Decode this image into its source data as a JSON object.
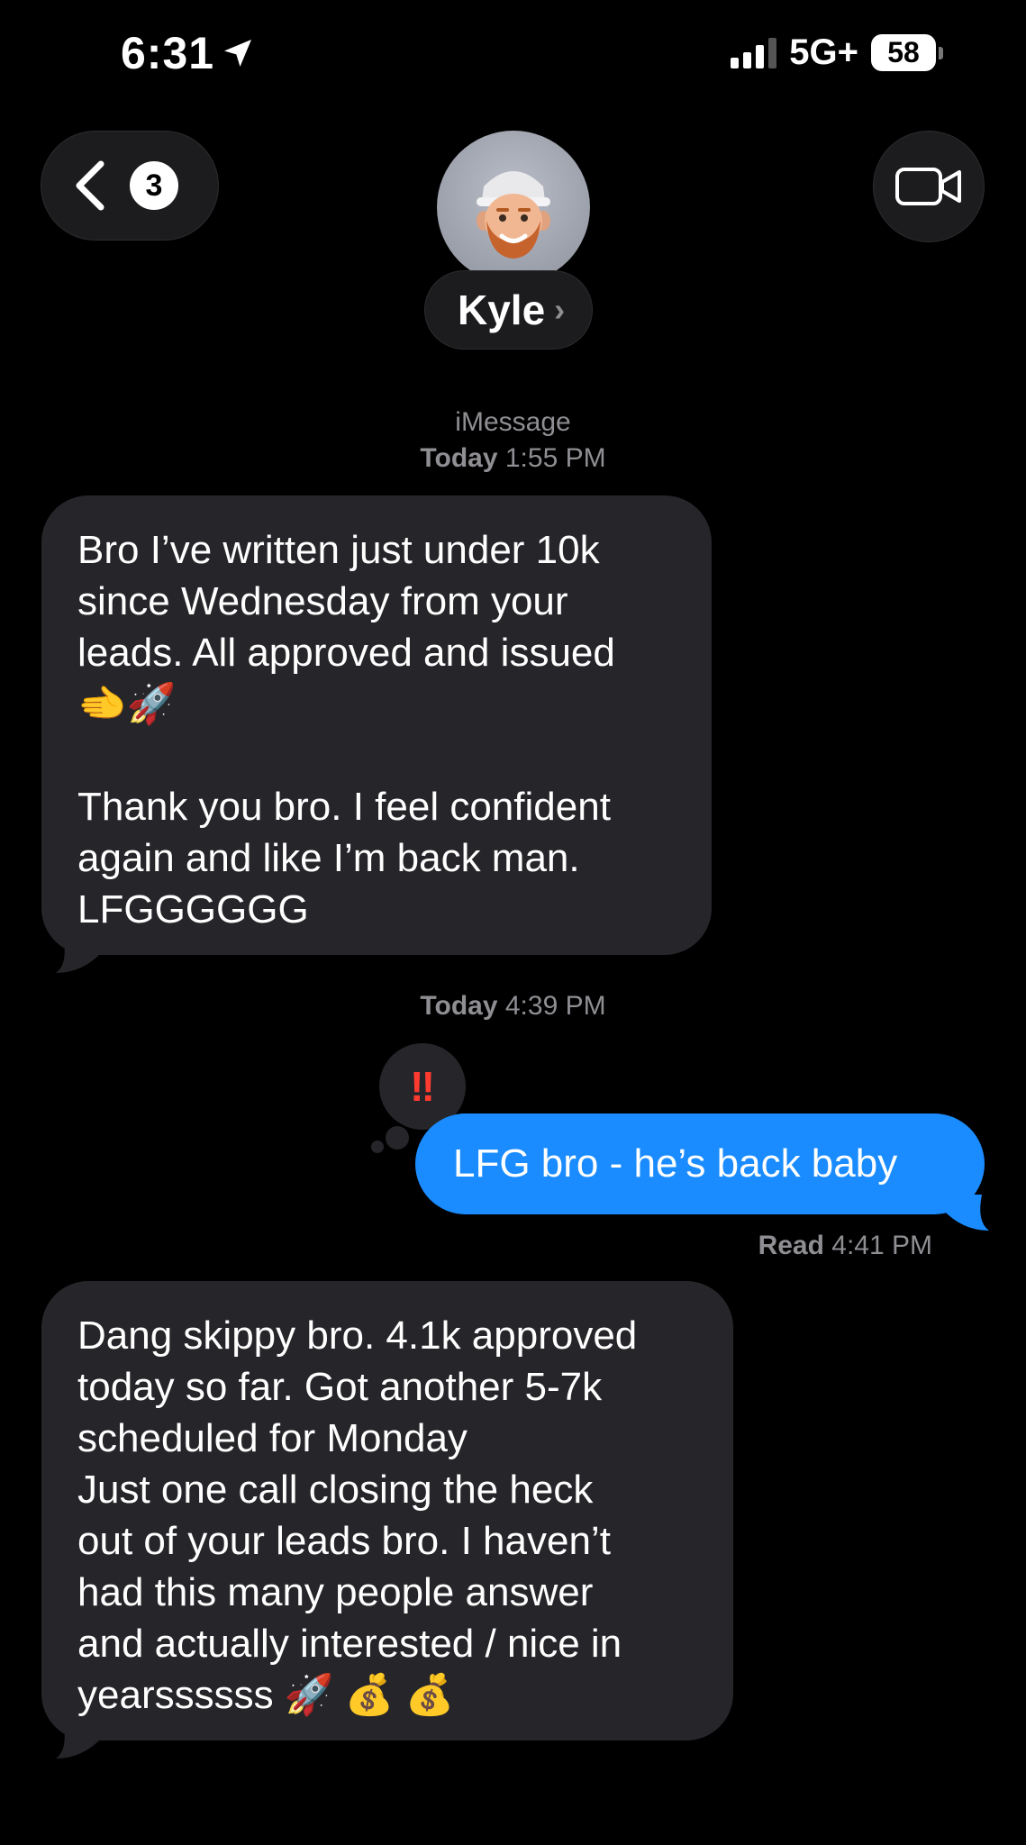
{
  "status_bar": {
    "time": "6:31",
    "network": "5G+",
    "battery": "58"
  },
  "header": {
    "back_badge": "3",
    "contact_name": "Kyle",
    "chevron": "›"
  },
  "conversation": {
    "service_label": "iMessage",
    "ts1_day": "Today",
    "ts1_time": "1:55 PM",
    "msg1": "Bro I’ve written just under 10k\nsince Wednesday from your\nleads. All approved and issued\n🫲🚀\n\nThank you bro. I feel confident\nagain and like I’m back man.\nLFGGGGGG",
    "ts2_day": "Today",
    "ts2_time": "4:39 PM",
    "tapback": "‼",
    "msg2": "LFG bro - he’s back baby",
    "read_label": "Read",
    "read_time": "4:41 PM",
    "msg3": "Dang skippy bro. 4.1k approved\ntoday so far. Got another 5-7k\nscheduled for Monday\nJust one call closing the heck\nout of your leads bro. I haven’t\nhad this many people answer\nand actually interested / nice in\nyearssssss 🚀 💰 💰"
  },
  "icons": [
    "location-arrow-icon",
    "signal-icon",
    "battery-icon",
    "back-chevron-icon",
    "video-camera-icon",
    "memoji-avatar"
  ],
  "colors": {
    "background": "#000000",
    "incoming_bubble": "#26262a",
    "outgoing_bubble": "#1a8cff",
    "meta_text": "#8e8e93",
    "tapback": "#ff3b30"
  }
}
